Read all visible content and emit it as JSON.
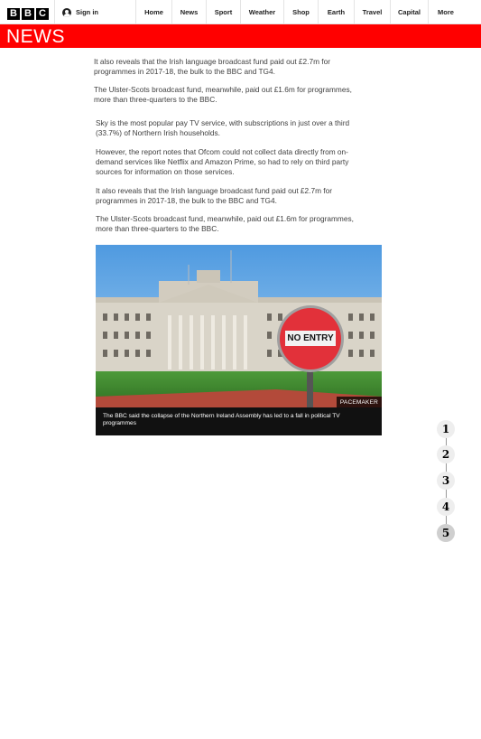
{
  "header": {
    "logo_letters": [
      "B",
      "B",
      "C"
    ],
    "sign_in": "Sign in",
    "nav": [
      "Home",
      "News",
      "Sport",
      "Weather",
      "Shop",
      "Earth",
      "Travel",
      "Capital",
      "More"
    ]
  },
  "band": {
    "title": "NEWS",
    "color": "#ff0000"
  },
  "article": {
    "paragraphs": [
      "It also reveals that the Irish language broadcast fund paid out £2.7m for programmes in 2017-18, the bulk to the BBC and TG4.",
      "The Ulster-Scots broadcast fund, meanwhile, paid out £1.6m for programmes, more than three-quarters to the BBC.",
      "Sky is the most popular pay TV service, with subscriptions in just over a third (33.7%) of Northern Irish households.",
      "However, the report notes that Ofcom could not collect data directly from on-demand services like Netflix and Amazon Prime, so had to rely on third party sources for information on those services.",
      "It also reveals that the Irish language broadcast fund paid out £2.7m for programmes in 2017-18, the bulk to the BBC and TG4.",
      "The Ulster-Scots broadcast fund, meanwhile, paid out £1.6m for programmes, more than three-quarters to the BBC."
    ],
    "image": {
      "sign_text": "NO ENTRY",
      "credit": "PACEMAKER",
      "caption": "The BBC said the collapse of the Northern Ireland Assembly has led to a fall in political TV programmes"
    }
  },
  "pager": {
    "pages": [
      "1",
      "2",
      "3",
      "4",
      "5"
    ],
    "active": "5"
  }
}
